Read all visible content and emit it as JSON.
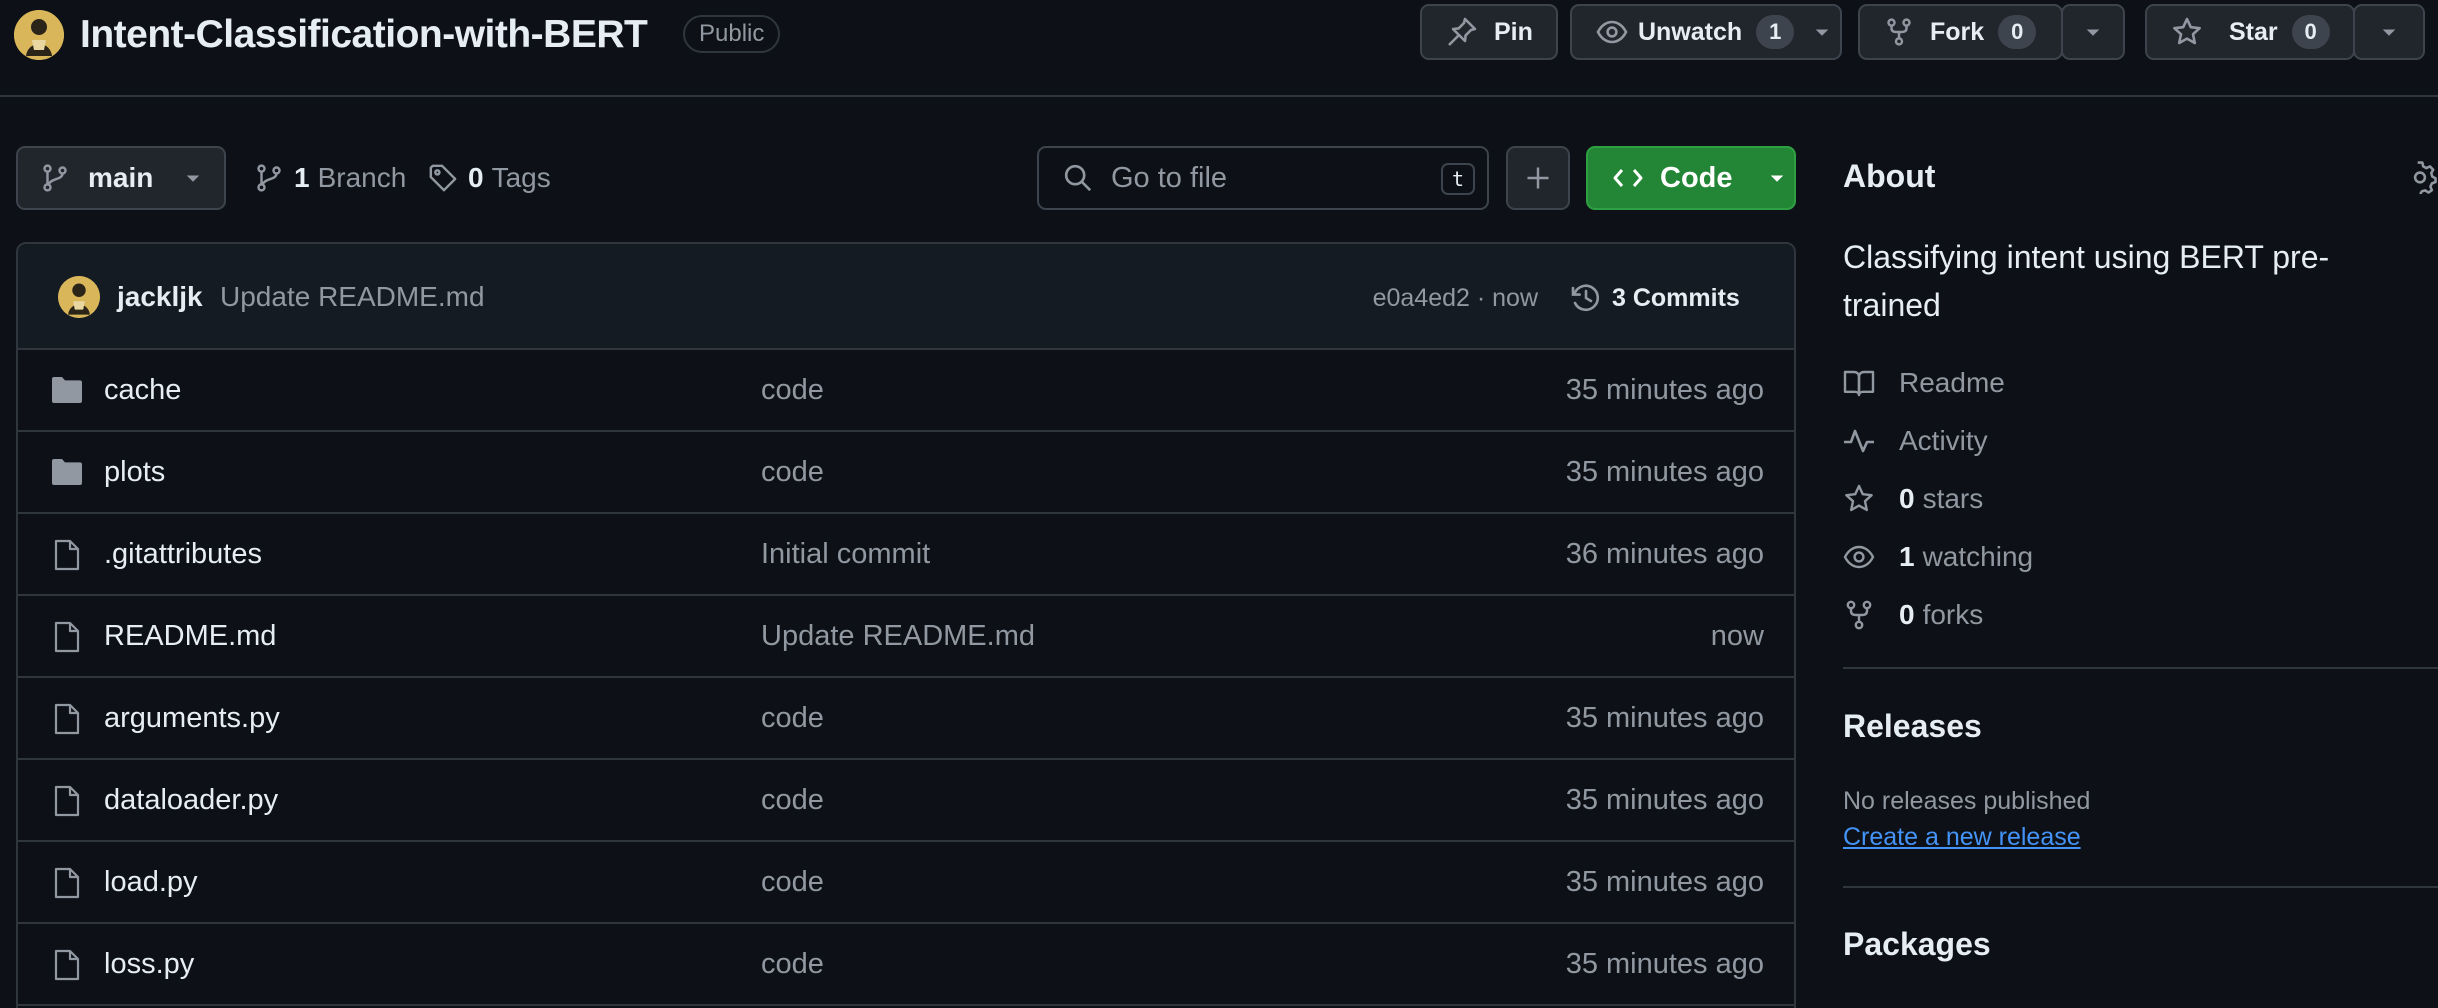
{
  "repo": {
    "name": "Intent-Classification-with-BERT",
    "visibility": "Public"
  },
  "header_actions": {
    "pin_label": "Pin",
    "watch_label": "Unwatch",
    "watch_count": "1",
    "fork_label": "Fork",
    "fork_count": "0",
    "star_label": "Star",
    "star_count": "0"
  },
  "branch_bar": {
    "current_branch": "main",
    "branch_count": "1",
    "branch_label": "Branch",
    "tag_count": "0",
    "tag_label": "Tags",
    "search_placeholder": "Go to file",
    "search_shortcut": "t",
    "code_label": "Code"
  },
  "latest_commit": {
    "author": "jackljk",
    "message": "Update README.md",
    "hash_time": "e0a4ed2 · now",
    "commits_label": "3 Commits"
  },
  "files": [
    {
      "type": "folder",
      "icon": "folder-icon",
      "name": "cache",
      "message": "code",
      "date": "35 minutes ago"
    },
    {
      "type": "folder",
      "icon": "folder-icon",
      "name": "plots",
      "message": "code",
      "date": "35 minutes ago"
    },
    {
      "type": "file",
      "icon": "file-icon",
      "name": ".gitattributes",
      "message": "Initial commit",
      "date": "36 minutes ago"
    },
    {
      "type": "file",
      "icon": "file-icon",
      "name": "README.md",
      "message": "Update README.md",
      "date": "now"
    },
    {
      "type": "file",
      "icon": "file-icon",
      "name": "arguments.py",
      "message": "code",
      "date": "35 minutes ago"
    },
    {
      "type": "file",
      "icon": "file-icon",
      "name": "dataloader.py",
      "message": "code",
      "date": "35 minutes ago"
    },
    {
      "type": "file",
      "icon": "file-icon",
      "name": "load.py",
      "message": "code",
      "date": "35 minutes ago"
    },
    {
      "type": "file",
      "icon": "file-icon",
      "name": "loss.py",
      "message": "code",
      "date": "35 minutes ago"
    }
  ],
  "about": {
    "heading": "About",
    "description": "Classifying intent using BERT pre-trained",
    "readme_label": "Readme",
    "activity_label": "Activity",
    "stars_count": "0",
    "stars_label": "stars",
    "watching_count": "1",
    "watching_label": "watching",
    "forks_count": "0",
    "forks_label": "forks"
  },
  "releases": {
    "heading": "Releases",
    "empty_text": "No releases published",
    "create_link": "Create a new release"
  },
  "packages": {
    "heading": "Packages"
  },
  "colors": {
    "background": "#0d1117",
    "border": "#30363d",
    "muted_text": "#9198a1",
    "code_button": "#238636",
    "link": "#4493f8"
  }
}
